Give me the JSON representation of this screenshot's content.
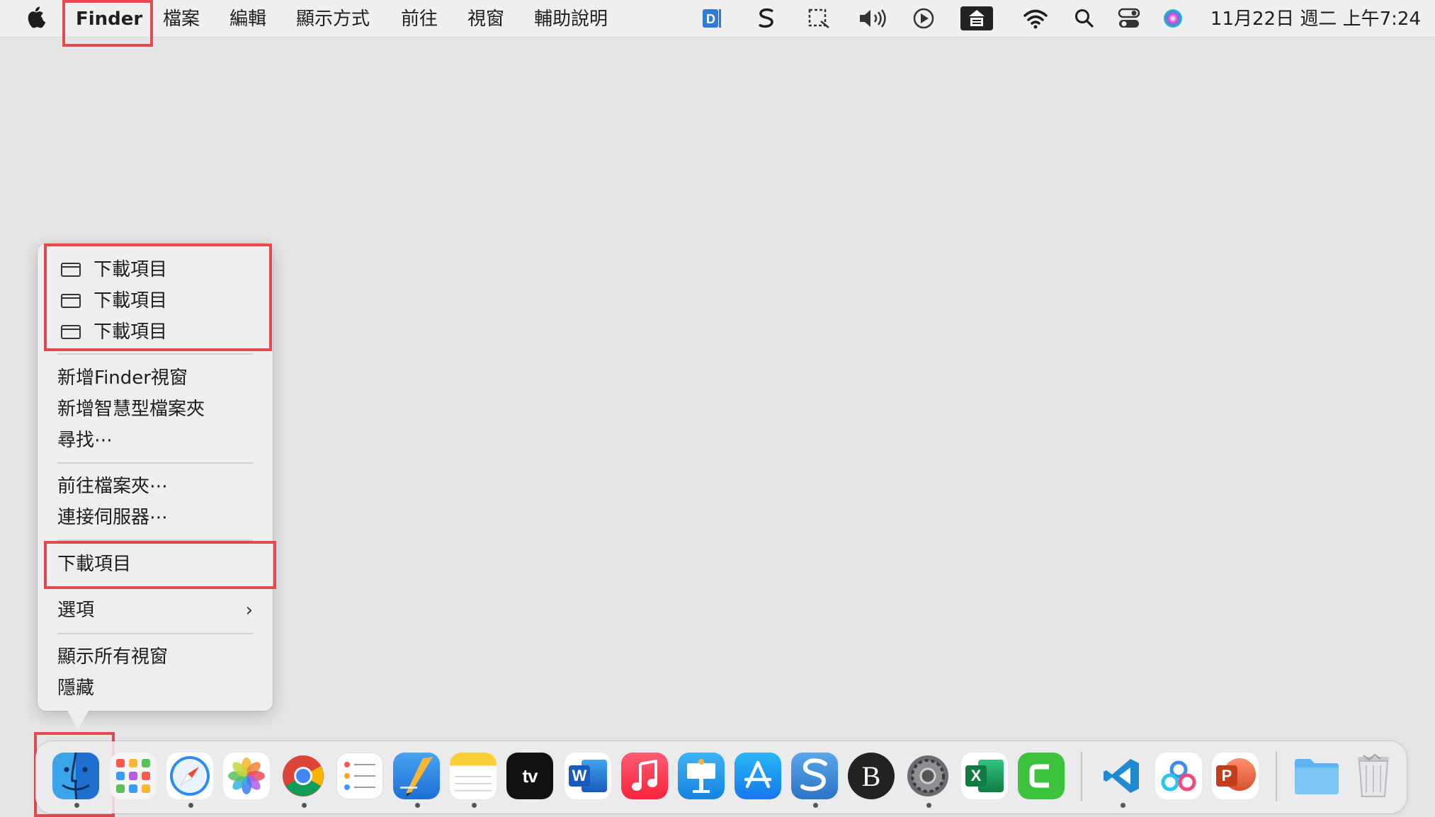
{
  "menubar": {
    "apple_icon": "apple-logo",
    "app_name": "Finder",
    "menus": [
      "檔案",
      "編輯",
      "顯示方式",
      "前往",
      "視窗",
      "輔助說明"
    ],
    "status_icons": [
      "dictation-icon",
      "scrivener-icon",
      "screenshot-icon",
      "volume-icon",
      "play-icon",
      "input-method-icon",
      "wifi-icon",
      "search-icon",
      "control-center-icon",
      "siri-icon"
    ],
    "clock": "11月22日 週二  上午7:24"
  },
  "dock_menu": {
    "windows": [
      "下載項目",
      "下載項目",
      "下載項目"
    ],
    "new_finder_window": "新增Finder視窗",
    "new_smart_folder": "新增智慧型檔案夾",
    "find": "尋找⋯",
    "go_to_folder": "前往檔案夾⋯",
    "connect_to_server": "連接伺服器⋯",
    "downloads": "下載項目",
    "options": "選項",
    "show_all_windows": "顯示所有視窗",
    "hide": "隱藏"
  },
  "dock": {
    "apps": [
      "Finder",
      "Launchpad",
      "Safari",
      "Photos",
      "Chrome",
      "Reminders",
      "Pages",
      "Notes",
      "TV",
      "Word",
      "Music",
      "Keynote",
      "App Store",
      "Scrivener",
      "Bear",
      "System Preferences",
      "Excel",
      "Camtasia",
      "VS Code",
      "Baidu Netdisk",
      "PowerPoint",
      "Folder",
      "Trash"
    ],
    "labels": {
      "tv": "tv",
      "word": "W",
      "excel": "X",
      "powerpoint": "P",
      "bear": "B"
    }
  },
  "colors": {
    "highlight": "#e5484d",
    "menubar": "#efeff1",
    "desktop": "#e5e5e7",
    "menu_bg": "#eeeef0"
  }
}
